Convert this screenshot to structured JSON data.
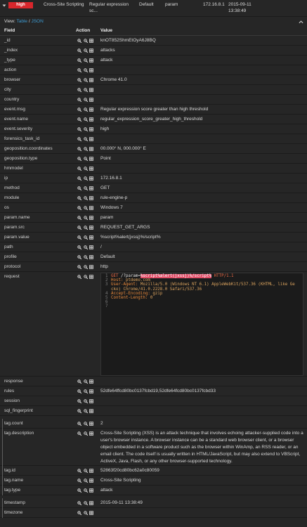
{
  "summary": {
    "severity": "high",
    "tag_name": "Cross-Site Scripting",
    "event_msg": "Regular expression sc...",
    "profile": "Default",
    "param_name": "param",
    "ip": "172.16.8.1",
    "timestamp": "2015-09-11 13:38:49"
  },
  "view": {
    "label": "View:",
    "table": "Table",
    "separator": "/",
    "json": "JSON"
  },
  "table_header": {
    "field": "Field",
    "action": "Action",
    "value": "Value"
  },
  "fields": [
    {
      "field": "_id",
      "value": "knOT852ShmEtOyA6J8BQ"
    },
    {
      "field": "_index",
      "value": "attacks"
    },
    {
      "field": "_type",
      "value": "attack"
    },
    {
      "field": "action",
      "value": ""
    },
    {
      "field": "browser",
      "value": "Chrome 41.0"
    },
    {
      "field": "city",
      "value": ""
    },
    {
      "field": "country",
      "value": ""
    },
    {
      "field": "event.msg",
      "value": "Regular expression score greater than high threshold"
    },
    {
      "field": "event.name",
      "value": "regular_expression_score_greater_high_threshold"
    },
    {
      "field": "event.severity",
      "value": "high"
    },
    {
      "field": "forensics_task_id",
      "value": ""
    },
    {
      "field": "geoposition.coordinates",
      "value": "00.000° N, 000.000° E"
    },
    {
      "field": "geoposition.type",
      "value": "Point"
    },
    {
      "field": "hmmodel",
      "value": ""
    },
    {
      "field": "ip",
      "value": "172.16.8.1"
    },
    {
      "field": "method",
      "value": "GET"
    },
    {
      "field": "module",
      "value": "rule-engine-p"
    },
    {
      "field": "os",
      "value": "Windows 7"
    },
    {
      "field": "param.name",
      "value": "param"
    },
    {
      "field": "param.src",
      "value": "REQUEST_GET_ARGS"
    },
    {
      "field": "param.value",
      "value": "%script%alert(jxssj)%/script%"
    },
    {
      "field": "path",
      "value": "/"
    },
    {
      "field": "profile",
      "value": "Default"
    },
    {
      "field": "protocol",
      "value": "http"
    }
  ],
  "request": {
    "field": "request",
    "code": {
      "line_numbers": [
        "1",
        "2",
        "3",
        "4",
        "5",
        "6",
        "7"
      ],
      "request_line": {
        "method": "GET",
        "path": "/?param=",
        "payload": "%script%alert(jxssj)%/script%",
        "protocol": "HTTP/1.1"
      },
      "headers": [
        {
          "key": "Host:",
          "value": "ptdemo.com"
        },
        {
          "key": "User-Agent:",
          "value": "Mozilla/5.0 (Windows NT 6.1) AppleWebKit/537.36 (KHTML, like Gecko) Chrome/41.0.2228.0 Safari/537.36"
        },
        {
          "key": "Accept-Encoding:",
          "value": "gzip"
        },
        {
          "key": "Content-Length:",
          "value": "0"
        }
      ]
    }
  },
  "fields_after_request": [
    {
      "field": "response",
      "value": ""
    },
    {
      "field": "rules",
      "value": "52dfe64ffcd80bc0137fcbd19,52dfe64fcd80bc0137fcbd33"
    },
    {
      "field": "session",
      "value": ""
    },
    {
      "field": "sql_fingerprint",
      "value": ""
    }
  ],
  "tag_fields": [
    {
      "field": "tag.count",
      "value": "2"
    },
    {
      "field": "tag.description",
      "value": "Cross-Site Scripting (XSS) is an attack technique that involves echoing attacker-supplied code into a user's browser instance. A browser instance can be a standard web browser client, or a browser object embedded in a software product such as the browser within WinAmp, an RSS reader, or an email client. The code itself is usually written in HTML/JavaScript, but may also extend to VBScript, ActiveX, Java, Flash, or any other browser-supported technology."
    },
    {
      "field": "tag.id",
      "value": "52863f20cd80bc62a0c80059"
    },
    {
      "field": "tag.name",
      "value": "Cross-Site Scripting"
    },
    {
      "field": "tag.type",
      "value": "attack"
    }
  ],
  "time_fields": [
    {
      "field": "timestamp",
      "value": "2015-09-11 13:38:49"
    },
    {
      "field": "timezone",
      "value": ""
    }
  ],
  "icons": {
    "expand_toggle": "caret-down-icon",
    "collapse": "chevron-up-icon",
    "row_actions": [
      "filter-for-value-icon",
      "filter-out-value-icon",
      "toggle-column-icon"
    ]
  },
  "colors": {
    "severity_badge": "#d9262c",
    "link": "#3d9ad1",
    "payload_highlight": "#e0506a"
  }
}
